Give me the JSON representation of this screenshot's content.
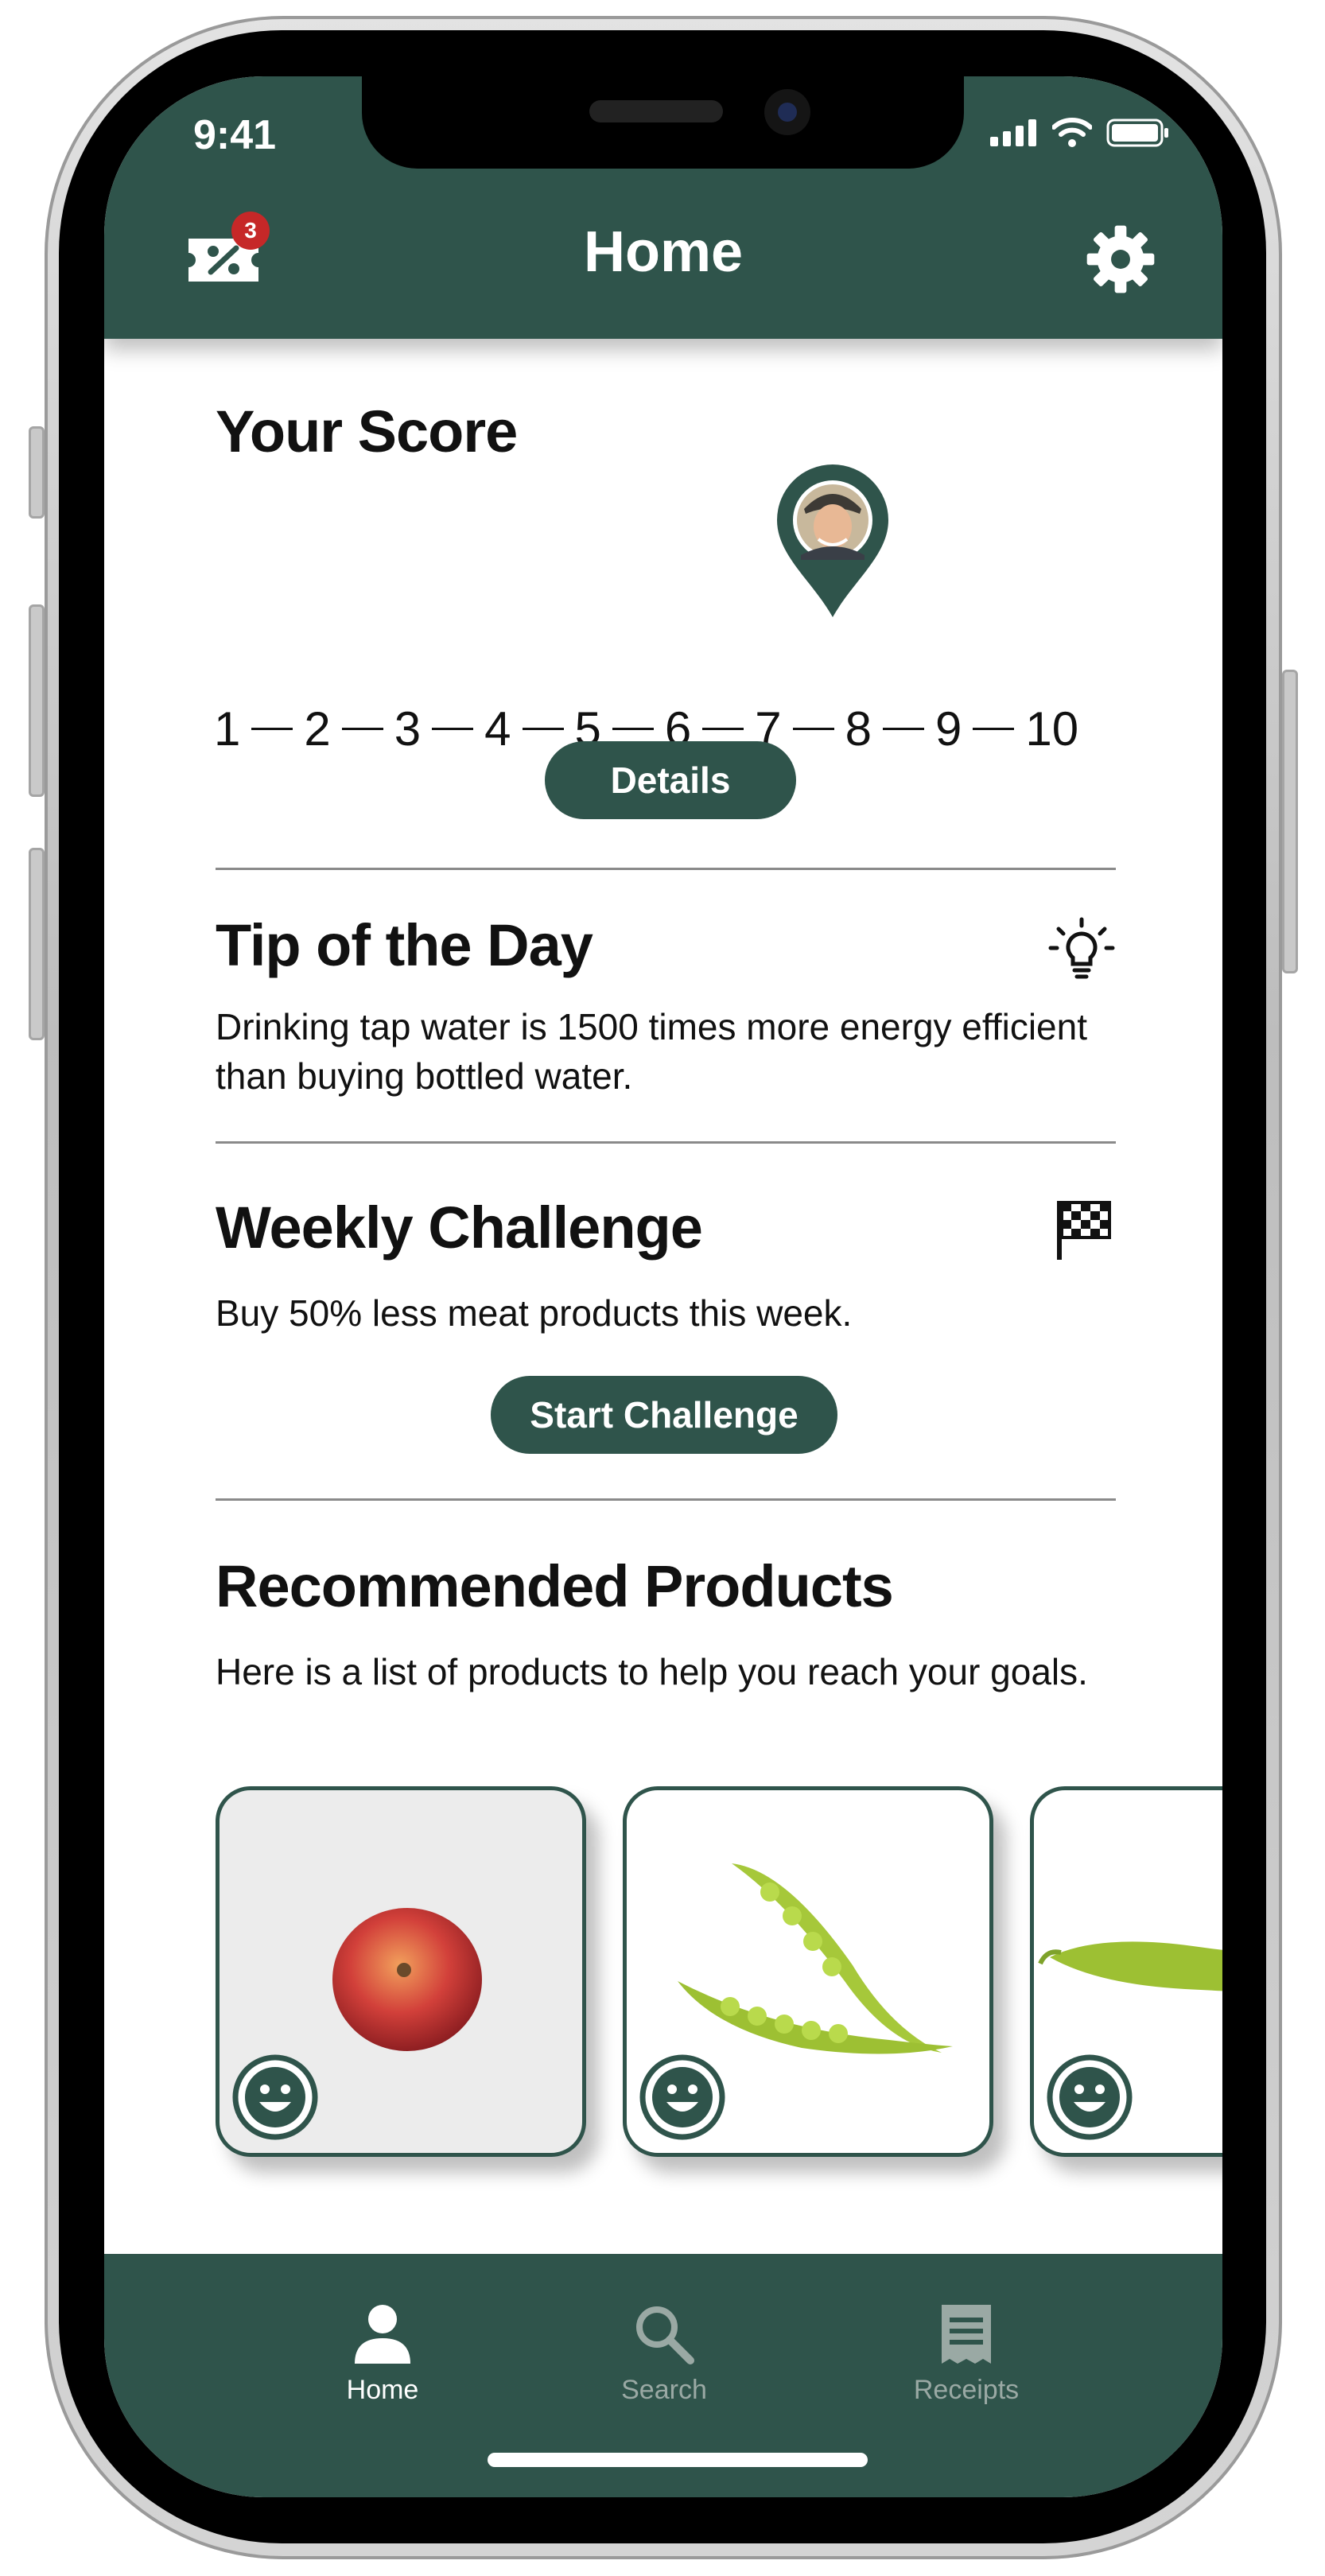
{
  "status_bar": {
    "time": "9:41"
  },
  "header": {
    "title": "Home",
    "coupon_badge_count": "3",
    "left_icon": "coupon-percent-icon",
    "right_icon": "gear-icon"
  },
  "score": {
    "title": "Your Score",
    "scale": [
      "1",
      "2",
      "3",
      "4",
      "5",
      "6",
      "7",
      "8",
      "9",
      "10"
    ],
    "current_value": 7.5,
    "details_label": "Details"
  },
  "tip": {
    "title": "Tip of the Day",
    "text": "Drinking tap water is 1500 times more energy efficient than buying bottled water.",
    "icon": "lightbulb-icon"
  },
  "challenge": {
    "title": "Weekly Challenge",
    "text": "Buy 50% less meat products this week.",
    "button_label": "Start Challenge",
    "icon": "checkered-flag-icon"
  },
  "recommended": {
    "title": "Recommended Products",
    "text": "Here is a list of products to help you reach your goals.",
    "products": [
      {
        "image": "apple",
        "rating_icon": "smiley-icon"
      },
      {
        "image": "pea-pods",
        "rating_icon": "smiley-icon"
      },
      {
        "image": "pea-pod",
        "rating_icon": "smiley-icon"
      }
    ]
  },
  "tabbar": {
    "home": "Home",
    "search": "Search",
    "receipts": "Receipts",
    "active": "Home"
  },
  "colors": {
    "primary": "#2f544b",
    "badge": "#c62828",
    "inactive_tab": "#9aa9a4"
  }
}
